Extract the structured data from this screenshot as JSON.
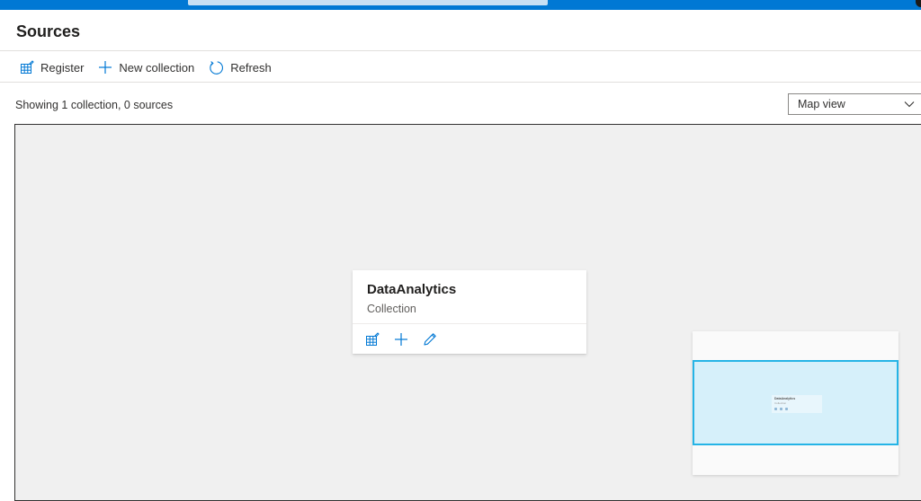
{
  "page": {
    "title": "Sources"
  },
  "toolbar": {
    "register_label": "Register",
    "new_collection_label": "New collection",
    "refresh_label": "Refresh"
  },
  "summary": {
    "text": "Showing 1 collection, 0 sources"
  },
  "view_select": {
    "selected": "Map view"
  },
  "collection_card": {
    "name": "DataAnalytics",
    "type": "Collection",
    "actions": [
      "grid-edit-icon",
      "plus-icon",
      "pencil-icon"
    ]
  },
  "minimap": {
    "card_name": "DataAnalytics",
    "card_type": "Collection"
  },
  "colors": {
    "accent": "#0078d4",
    "canvas_background": "#f0f0f0",
    "minimap_viewport_border": "#25b4e6",
    "minimap_viewport_fill": "#d6f0fa"
  },
  "icons": {
    "register": "grid-edit-icon",
    "new_collection": "plus-icon",
    "refresh": "refresh-icon",
    "dropdown": "chevron-down-icon"
  }
}
